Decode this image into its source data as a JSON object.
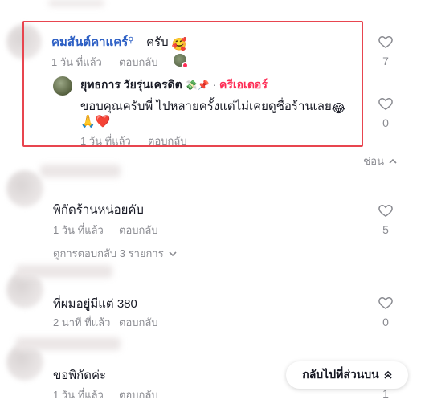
{
  "comments": [
    {
      "author": "คมสันต์คาแคร์",
      "text": "ครับ",
      "emoji": "🥰",
      "time": "1 วัน ที่แล้ว",
      "reply_label": "ตอบกลับ",
      "likes": "7",
      "reply": {
        "author": "ยุทธการ วัยรุ่นเครดิต",
        "badges": "💸📌",
        "role": "ครีเอเตอร์",
        "text_line1": "ขอบคุณครับพี่ ไปหลายครั้งแต่ไม่เคยดูชื่อร้านเลย",
        "emoji_line1": "😂",
        "emoji_line2": "🙏❤️",
        "time": "1 วัน ที่แล้ว",
        "reply_label": "ตอบกลับ",
        "likes": "0"
      },
      "hide_label": "ซ่อน"
    },
    {
      "text": "พิกัดร้านหน่อยคับ",
      "time": "1 วัน ที่แล้ว",
      "reply_label": "ตอบกลับ",
      "likes": "5",
      "view_replies_label": "ดูการตอบกลับ 3 รายการ"
    },
    {
      "text": "ที่ผมอยู่มีแต่ 380",
      "time": "2 นาที ที่แล้ว",
      "reply_label": "ตอบกลับ",
      "likes": "0"
    },
    {
      "text": "ขอพิกัดค่ะ",
      "time": "1 วัน ที่แล้ว",
      "reply_label": "ตอบกลับ",
      "likes": "1"
    }
  ],
  "back_to_top_label": "กลับไปที่ส่วนบน",
  "colors": {
    "author_blue": "#2b5ec4",
    "creator_red": "#fe2c55",
    "highlight_border": "#e8454f",
    "meta_gray": "#8a8b91"
  }
}
